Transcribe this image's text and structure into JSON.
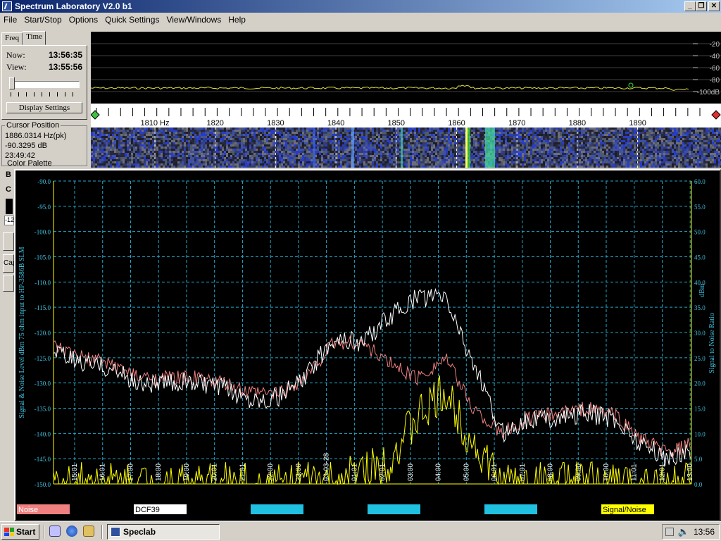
{
  "window": {
    "title": "Spectrum Laboratory V2.0 b1"
  },
  "menu": [
    "File",
    "Start/Stop",
    "Options",
    "Quick Settings",
    "View/Windows",
    "Help"
  ],
  "left_panel": {
    "tabs": [
      "Freq",
      "Time"
    ],
    "now_label": "Now:",
    "now_value": "13:56:35",
    "view_label": "View:",
    "view_value": "13:55:56",
    "display_settings": "Display Settings",
    "cursor_title": "Cursor Position",
    "cursor_freq": "1886.0314 Hz(pk)",
    "cursor_db": "-90.3295 dB",
    "cursor_time": "23:49:42",
    "color_palette": "Color Palette",
    "partial_labels": [
      "B",
      "C",
      "-12",
      "Cap"
    ]
  },
  "spectrum": {
    "db_ticks": [
      "-20",
      "-40",
      "-60",
      "-80",
      "-100dB"
    ],
    "freq_labels": [
      "1810 Hz",
      "1820",
      "1830",
      "1840",
      "1850",
      "1860",
      "1870",
      "1880",
      "1890"
    ]
  },
  "plot": {
    "left_axis_label": "Signal & Noise Level  dBm 75 ohm input to HP-3586B SLM",
    "right_axis_label_1": "dBm",
    "right_axis_label_2": "Signal to Noise Ratio",
    "left_ticks": [
      "-90.0",
      "-95.0",
      "-100.0",
      "-105.0",
      "-110.0",
      "-115.0",
      "-120.0",
      "-125.0",
      "-130.0",
      "-135.0",
      "-140.0",
      "-145.0",
      "-150.0"
    ],
    "right_ticks": [
      "60.0",
      "55.0",
      "50.0",
      "45.0",
      "40.0",
      "35.0",
      "30.0",
      "25.0",
      "20.0",
      "15.0",
      "10.0",
      "5.0",
      "0.0"
    ],
    "time_ticks": [
      "15:01",
      "16:01",
      "17:00",
      "18:00",
      "19:00",
      "20:01",
      "21:01",
      "22:00",
      "23:00",
      "03-03-28",
      "01:01",
      "02:01",
      "03:00",
      "04:00",
      "05:00",
      "06:01",
      "07:01",
      "08:00",
      "09:00",
      "10:00",
      "11:01",
      "12:01",
      "13:00"
    ],
    "legend": [
      {
        "label": "Noise",
        "bg": "#f08080",
        "fg": "#ffffff"
      },
      {
        "label": "DCF39",
        "bg": "#ffffff",
        "fg": "#000000"
      },
      {
        "label": "",
        "bg": "#20c0e0",
        "fg": "#000000"
      },
      {
        "label": "",
        "bg": "#20c0e0",
        "fg": "#000000"
      },
      {
        "label": "",
        "bg": "#20c0e0",
        "fg": "#000000"
      },
      {
        "label": "Signal/Noise",
        "bg": "#ffff00",
        "fg": "#000000"
      }
    ],
    "colors": {
      "grid": "#20a8c8",
      "axis": "#ffff00",
      "noise": "#f08080",
      "signal": "#ffffff",
      "snr": "#ffff00",
      "label": "#40c0e0"
    }
  },
  "chart_data": {
    "type": "line",
    "x": [
      0,
      1,
      2,
      3,
      4,
      5,
      6,
      7,
      8,
      9,
      10,
      11,
      12,
      13,
      14,
      15,
      16,
      17,
      18,
      19,
      20,
      21,
      22,
      22.8
    ],
    "series": [
      {
        "name": "Noise",
        "values": [
          -123,
          -125,
          -126,
          -129,
          -129,
          -129,
          -130,
          -132,
          -132,
          -129,
          -122,
          -122,
          -126,
          -129,
          -125,
          -135,
          -140,
          -137,
          -136,
          -135,
          -136,
          -141,
          -144,
          -142
        ]
      },
      {
        "name": "DCF39",
        "values": [
          -124,
          -126,
          -127,
          -130,
          -130,
          -130,
          -131,
          -133,
          -133,
          -129,
          -121,
          -122,
          -117,
          -113,
          -113,
          -126,
          -140,
          -137,
          -137,
          -136,
          -137,
          -142,
          -145,
          -143
        ]
      },
      {
        "name": "Signal/Noise",
        "values": [
          0,
          0,
          0,
          0,
          0,
          0,
          0,
          0,
          0,
          0,
          0,
          2,
          5,
          13,
          18,
          8,
          0,
          0,
          0,
          0,
          0,
          0,
          0,
          0
        ]
      }
    ],
    "xlim": [
      0,
      22.8
    ],
    "ylim": [
      -150,
      -90
    ],
    "y2lim": [
      0,
      60
    ],
    "grid": true,
    "legend_position": "bottom"
  },
  "taskbar": {
    "start": "Start",
    "task": "Speclab",
    "clock": "13:56"
  }
}
